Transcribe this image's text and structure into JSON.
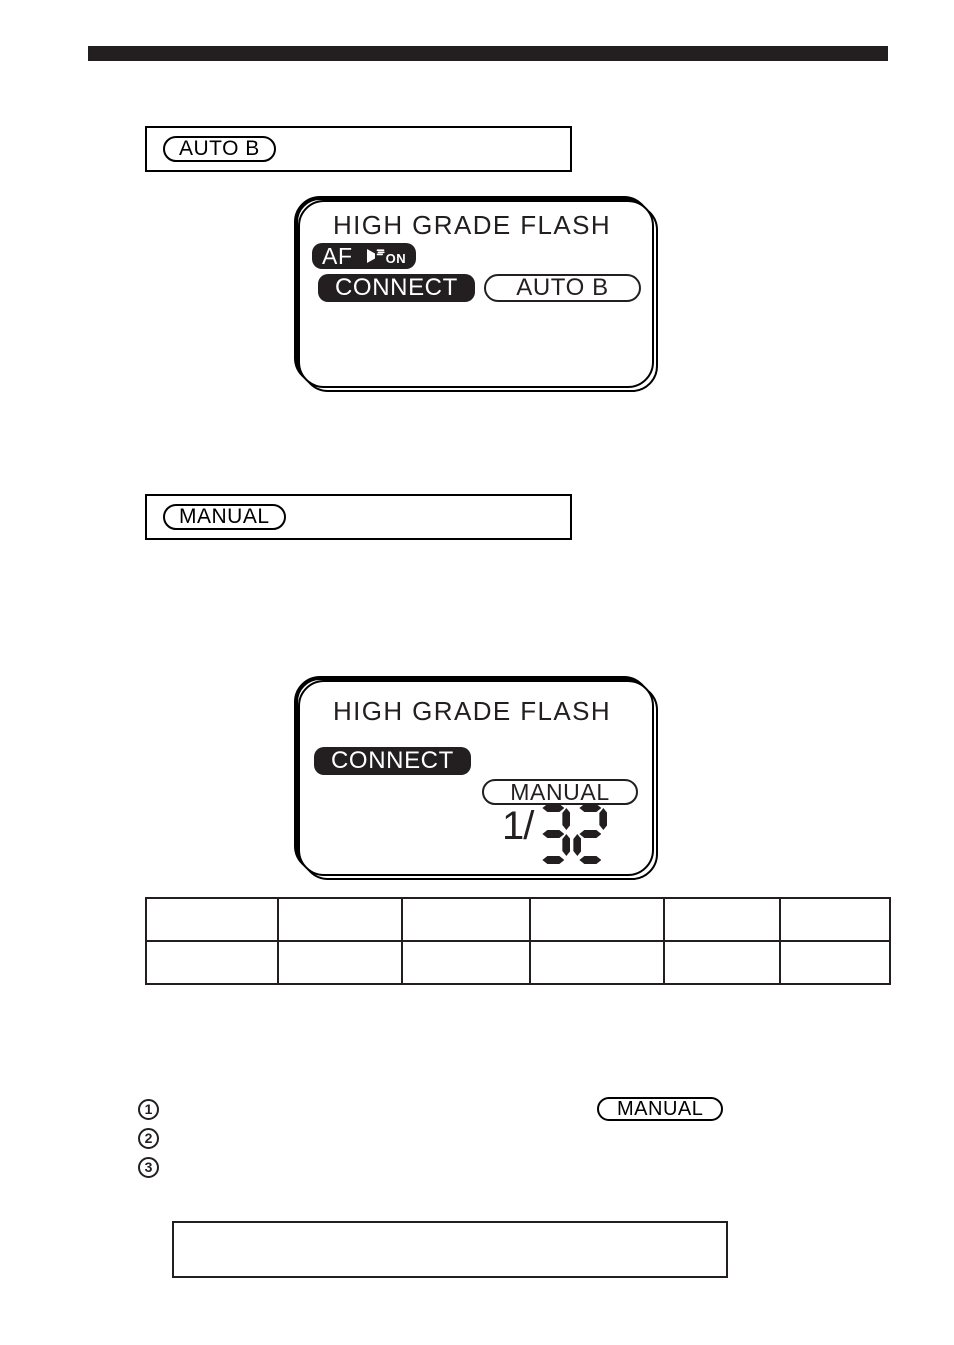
{
  "page": {
    "header_rule": true
  },
  "caption_auto_b": {
    "label": "AUTO B"
  },
  "caption_manual": {
    "label": "MANUAL"
  },
  "lcd_panel_auto_b": {
    "title": "HIGH GRADE FLASH",
    "af_label": "AF",
    "af_icon": "af-illuminator-beam-icon",
    "af_state": "ON",
    "connect_label": "CONNECT",
    "mode_label": "AUTO B"
  },
  "lcd_panel_manual": {
    "title": "HIGH GRADE FLASH",
    "connect_label": "CONNECT",
    "mode_label": "MANUAL",
    "power_prefix": "1/",
    "power_digits": "32"
  },
  "spec_table": {
    "columns": 6,
    "rows": [
      [
        "",
        "",
        "",
        "",
        "",
        ""
      ],
      [
        "",
        "",
        "",
        "",
        "",
        ""
      ]
    ]
  },
  "steps": {
    "items": [
      {
        "number": "1",
        "text": ""
      },
      {
        "number": "2",
        "text": ""
      },
      {
        "number": "3",
        "text": ""
      }
    ],
    "reference_pill": "MANUAL"
  },
  "note_box": {
    "text": ""
  },
  "colors": {
    "ink": "#231f20",
    "paper": "#ffffff"
  }
}
